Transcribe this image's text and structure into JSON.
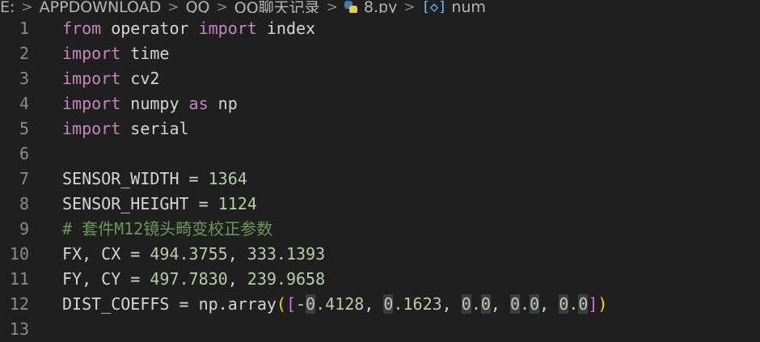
{
  "breadcrumb": {
    "items": [
      "E:",
      "APPDOWNLOAD",
      "QQ",
      "QQ聊天记录",
      "8.py",
      "num"
    ],
    "separator": ">"
  },
  "editor": {
    "lines": [
      {
        "n": "1",
        "tokens": [
          {
            "t": "from",
            "c": "kw"
          },
          {
            "t": " operator ",
            "c": ""
          },
          {
            "t": "import",
            "c": "kw"
          },
          {
            "t": " index",
            "c": ""
          }
        ]
      },
      {
        "n": "2",
        "tokens": [
          {
            "t": "import",
            "c": "kw"
          },
          {
            "t": " time",
            "c": ""
          }
        ]
      },
      {
        "n": "3",
        "tokens": [
          {
            "t": "import",
            "c": "kw"
          },
          {
            "t": " cv2",
            "c": ""
          }
        ]
      },
      {
        "n": "4",
        "tokens": [
          {
            "t": "import",
            "c": "kw"
          },
          {
            "t": " numpy ",
            "c": ""
          },
          {
            "t": "as",
            "c": "kw"
          },
          {
            "t": " np",
            "c": ""
          }
        ]
      },
      {
        "n": "5",
        "tokens": [
          {
            "t": "import",
            "c": "kw"
          },
          {
            "t": " serial",
            "c": ""
          }
        ]
      },
      {
        "n": "6",
        "tokens": []
      },
      {
        "n": "7",
        "tokens": [
          {
            "t": "SENSOR_WIDTH = ",
            "c": ""
          },
          {
            "t": "1364",
            "c": "num"
          }
        ]
      },
      {
        "n": "8",
        "tokens": [
          {
            "t": "SENSOR_HEIGHT = ",
            "c": ""
          },
          {
            "t": "1124",
            "c": "num"
          }
        ]
      },
      {
        "n": "9",
        "tokens": [
          {
            "t": "# 套件M12镜头畸变校正参数",
            "c": "cm"
          }
        ]
      },
      {
        "n": "10",
        "tokens": [
          {
            "t": "FX, CX = ",
            "c": ""
          },
          {
            "t": "494.3755",
            "c": "num"
          },
          {
            "t": ", ",
            "c": ""
          },
          {
            "t": "333.1393",
            "c": "num"
          }
        ]
      },
      {
        "n": "11",
        "tokens": [
          {
            "t": "FY, CY = ",
            "c": ""
          },
          {
            "t": "497.7830",
            "c": "num"
          },
          {
            "t": ", ",
            "c": ""
          },
          {
            "t": "239.9658",
            "c": "num"
          }
        ]
      },
      {
        "n": "12",
        "tokens": [
          {
            "t": "DIST_COEFFS = np.array",
            "c": ""
          },
          {
            "t": "(",
            "c": "br1"
          },
          {
            "t": "[",
            "c": "br2"
          },
          {
            "t": "-",
            "c": ""
          },
          {
            "t": "0",
            "c": "num zero-hl"
          },
          {
            "t": ".4128",
            "c": "num"
          },
          {
            "t": ", ",
            "c": ""
          },
          {
            "t": "0",
            "c": "num zero-hl"
          },
          {
            "t": ".1623",
            "c": "num"
          },
          {
            "t": ", ",
            "c": ""
          },
          {
            "t": "0",
            "c": "num zero-hl"
          },
          {
            "t": ".",
            "c": "num"
          },
          {
            "t": "0",
            "c": "num zero-hl"
          },
          {
            "t": ", ",
            "c": ""
          },
          {
            "t": "0",
            "c": "num zero-hl"
          },
          {
            "t": ".",
            "c": "num"
          },
          {
            "t": "0",
            "c": "num zero-hl"
          },
          {
            "t": ", ",
            "c": ""
          },
          {
            "t": "0",
            "c": "num zero-hl"
          },
          {
            "t": ".",
            "c": "num"
          },
          {
            "t": "0",
            "c": "num zero-hl"
          },
          {
            "t": "]",
            "c": "br2"
          },
          {
            "t": ")",
            "c": "br1"
          }
        ]
      },
      {
        "n": "13",
        "tokens": []
      }
    ]
  },
  "colors": {
    "background": "#1f1f1f",
    "keyword": "#c586c0",
    "number": "#b5cea8",
    "comment": "#6a9955",
    "text": "#d4d4d4",
    "line_number": "#8c8c8c"
  },
  "icons": {
    "file": "python-file-icon",
    "symbol": "variable-symbol-icon"
  }
}
